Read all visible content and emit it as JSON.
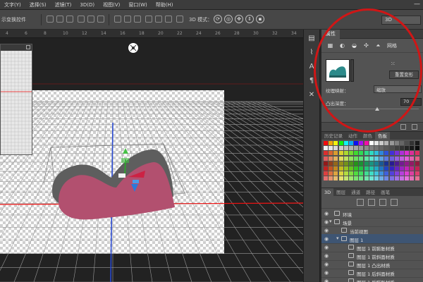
{
  "menubar": {
    "items": [
      "文字(Y)",
      "选择(S)",
      "滤镜(T)",
      "3D(D)",
      "视图(V)",
      "窗口(W)",
      "帮助(H)"
    ],
    "window_minimize": "—"
  },
  "options_bar": {
    "show_transform_label": "示变换控件",
    "mode_label": "3D 模式：",
    "mode_value": "3D",
    "light_icon_glyph": "☼"
  },
  "ruler": {
    "ticks": [
      "4",
      "6",
      "8",
      "10",
      "12",
      "14",
      "16",
      "18",
      "20",
      "22",
      "24",
      "26",
      "28",
      "30",
      "32",
      "34"
    ]
  },
  "toolstrip": {
    "icons": [
      "history-icon",
      "brush-panel-icon",
      "character-panel-icon",
      "paragraph-panel-icon",
      "tools-icon"
    ]
  },
  "properties": {
    "tab_label": "属性",
    "mesh_label": "网格",
    "reset_button": "重置变形",
    "texture_map_label": "纹理映射：",
    "texture_map_value": "缩放",
    "extrusion_label": "凸出深度：",
    "extrusion_value": "70",
    "extrusion_fraction": 0.55
  },
  "swatch_panel": {
    "tabs": [
      "历史记录",
      "动作",
      "颜色",
      "色板"
    ],
    "active_tab": "色板"
  },
  "layers_panel": {
    "tabs": [
      "3D",
      "图层",
      "通道",
      "路径",
      "画笔"
    ],
    "active_tab": "3D",
    "rows": [
      {
        "name": "环境",
        "indent": 0,
        "type": "env",
        "selected": false
      },
      {
        "name": "场景",
        "indent": 0,
        "type": "scene",
        "selected": false
      },
      {
        "name": "当前视图",
        "indent": 1,
        "type": "camera",
        "selected": false
      },
      {
        "name": "图层 1",
        "indent": 1,
        "type": "mesh",
        "selected": true
      },
      {
        "name": "图层 1 前膨胀材质",
        "indent": 2,
        "type": "material",
        "selected": false
      },
      {
        "name": "图层 1 前斜面材质",
        "indent": 2,
        "type": "material",
        "selected": false
      },
      {
        "name": "图层 1 凸出材质",
        "indent": 2,
        "type": "material",
        "selected": false
      },
      {
        "name": "图层 1 后斜面材质",
        "indent": 2,
        "type": "material",
        "selected": false
      },
      {
        "name": "图层 1 后膨胀材质",
        "indent": 2,
        "type": "material",
        "selected": false
      }
    ]
  },
  "colors": {
    "accent_red": "#d01616",
    "mesh_front": "#b2506f",
    "mesh_side": "#5e5e5e",
    "selection_blue": "#3e5573"
  }
}
